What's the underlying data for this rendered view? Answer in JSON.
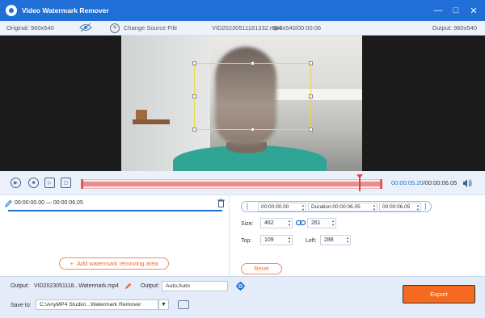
{
  "window": {
    "title": "Video Watermark Remover",
    "minimize": "—",
    "maximize": "□",
    "close": "✕"
  },
  "infobar": {
    "original": "Original: 960x540",
    "change_source": "Change Source File",
    "filename": "VID20230511181332.mp4",
    "resolution_duration": "960x540/00:00:06",
    "output": "Output: 960x540"
  },
  "player": {
    "current_time": "00:00:05.20",
    "total_time": "/00:00:06.05",
    "progress": 0.925
  },
  "segment": {
    "range": "00:00:00.00 — 00:00:06.05"
  },
  "add_area_label": "Add watermark removing area",
  "params": {
    "start": "00:00:00.00",
    "duration": "Duration:00:00:06.05",
    "end": "00:00:06.05",
    "size_label": "Size:",
    "width": "462",
    "height": "261",
    "top_label": "Top:",
    "top": "109",
    "left_label": "Left:",
    "left": "288",
    "reset": "Reset"
  },
  "bottom": {
    "output_label": "Output:",
    "output_file": "VID2023051118...Watermark.mp4",
    "output2_label": "Output:",
    "output_format": "Auto;Auto",
    "save_label": "Save to:",
    "save_path": "C:\\AnyMP4 Studio\\...Watermark Remover",
    "export": "Export"
  },
  "colors": {
    "brand": "#1f6fd6",
    "accent": "#f56a1f",
    "timeline": "#e88e8e",
    "selection": "#e8d84a"
  }
}
